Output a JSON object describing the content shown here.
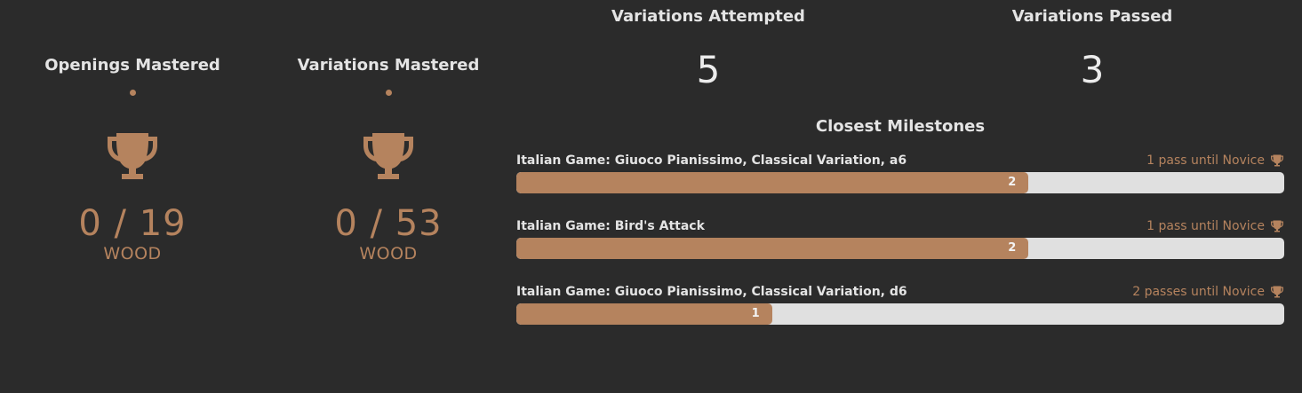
{
  "colors": {
    "background": "#2b2b2b",
    "accent": "#b5835e",
    "track": "#e0e0e0",
    "text": "#e4e4e4"
  },
  "stats": [
    {
      "title": "Openings Mastered",
      "icon": "trophy-icon",
      "count": "0 / 19",
      "tier": "WOOD"
    },
    {
      "title": "Variations Mastered",
      "icon": "trophy-icon",
      "count": "0 / 53",
      "tier": "WOOD"
    }
  ],
  "summary": {
    "attempted": {
      "title": "Variations Attempted",
      "value": "5"
    },
    "passed": {
      "title": "Variations Passed",
      "value": "3"
    }
  },
  "milestones": {
    "title": "Closest Milestones",
    "items": [
      {
        "name": "Italian Game: Giuoco Pianissimo, Classical Variation, a6",
        "until": "1 pass until Novice",
        "icon": "trophy-icon",
        "value": "2",
        "progress": 0.667
      },
      {
        "name": "Italian Game: Bird's Attack",
        "until": "1 pass until Novice",
        "icon": "trophy-icon",
        "value": "2",
        "progress": 0.667
      },
      {
        "name": "Italian Game: Giuoco Pianissimo, Classical Variation, d6",
        "until": "2 passes until Novice",
        "icon": "trophy-icon",
        "value": "1",
        "progress": 0.333
      }
    ]
  }
}
